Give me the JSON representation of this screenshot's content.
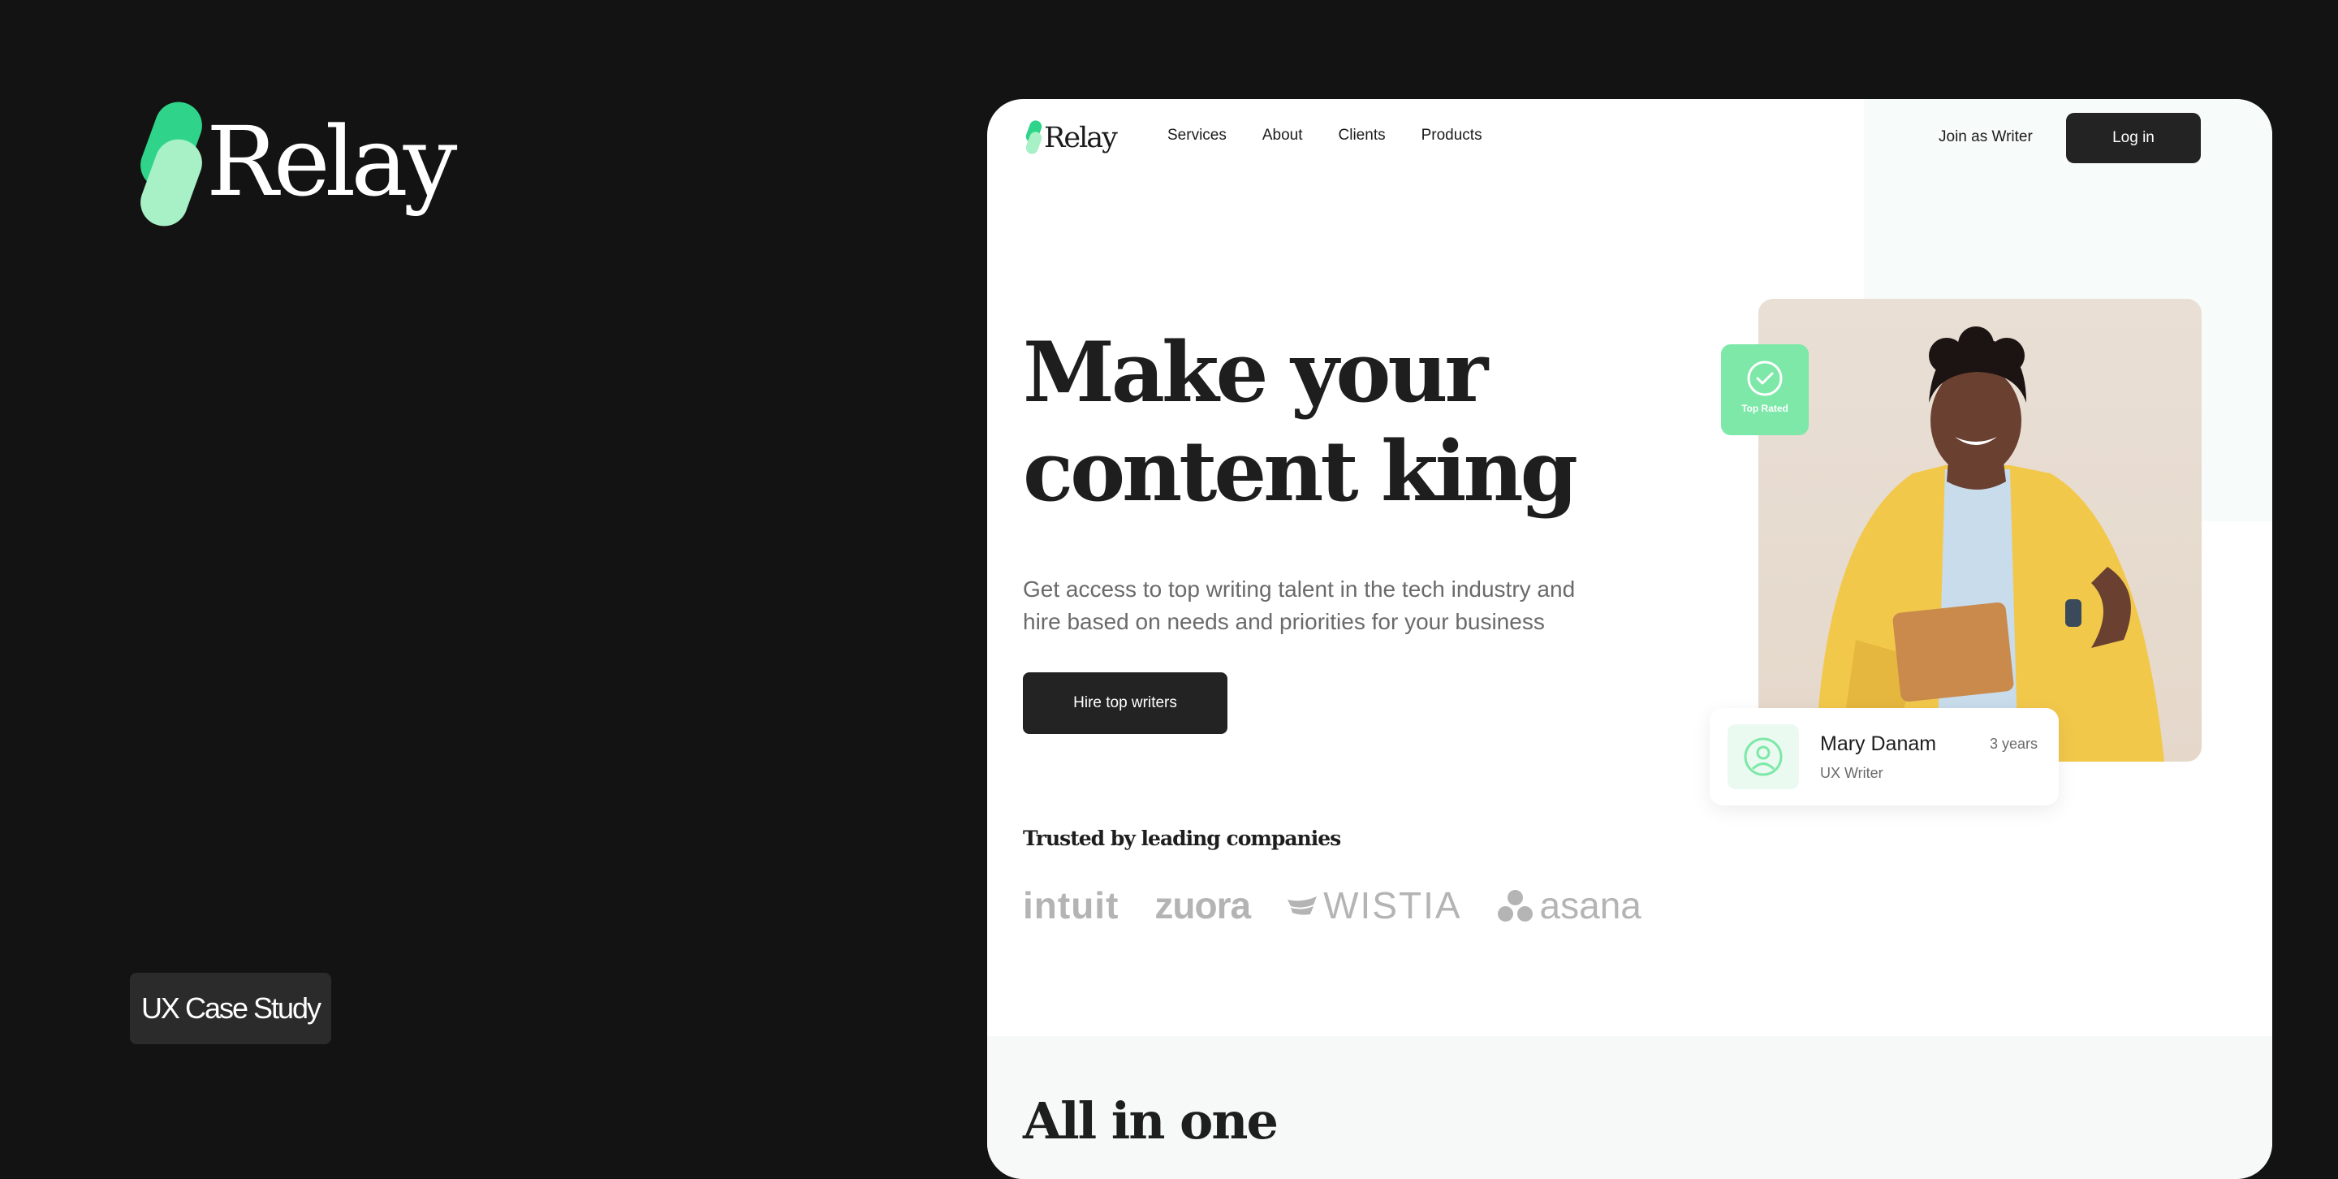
{
  "brand": {
    "name": "Relay",
    "mark_colors": [
      "#2fd48a",
      "#a8f0c6"
    ]
  },
  "case_badge": "UX Case Study",
  "nav": {
    "logo": "Relay",
    "links": [
      "Services",
      "About",
      "Clients",
      "Products"
    ],
    "join": "Join as Writer",
    "login": "Log in"
  },
  "hero": {
    "headline_line1": "Make your",
    "headline_line2": "content king",
    "subtitle": "Get access to top writing talent in the tech industry and hire based on needs and priorities for your business",
    "cta": "Hire top writers"
  },
  "trusted": {
    "title": "Trusted by leading companies",
    "logos": [
      "intuit",
      "zuora",
      "WISTIA",
      "asana"
    ]
  },
  "badge": {
    "label": "Top Rated",
    "icon": "check-circle-icon"
  },
  "profile": {
    "name": "Mary Danam",
    "role": "UX Writer",
    "years": "3 years",
    "icon": "user-icon"
  },
  "section2": {
    "title": "All in one"
  },
  "colors": {
    "background": "#131313",
    "accent": "#7de8a8",
    "button": "#232323"
  }
}
